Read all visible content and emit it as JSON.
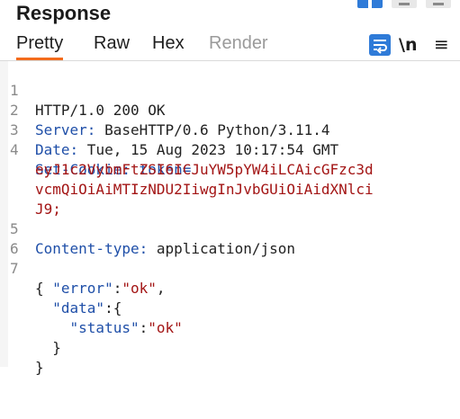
{
  "header": {
    "title": "Response"
  },
  "tabs": [
    {
      "label": "Pretty"
    },
    {
      "label": "Raw"
    },
    {
      "label": "Hex"
    },
    {
      "label": "Render"
    }
  ],
  "toolbar": {
    "newline_label": "\\n",
    "menu_glyph": "≡"
  },
  "lines": [
    {
      "num": "1",
      "text": "HTTP/1.0 200 OK"
    },
    {
      "num": "2",
      "key": "Server:",
      "value": " BaseHTTP/0.6 Python/3.11.4"
    },
    {
      "num": "3",
      "key": "Date:",
      "value": " Tue, 15 Aug 2023 10:17:54 GMT"
    },
    {
      "num": "4",
      "key": "Set-Cookie:",
      "value": " token="
    },
    {
      "num": "",
      "token": "eyJ1c2VybmFtZSI6ICJuYW5pYW4iLCAicGFzc3d"
    },
    {
      "num": "",
      "token": "vcmQiOiAiMTIzNDU2IiwgInJvbGUiOiAidXNlci"
    },
    {
      "num": "",
      "token": "J9;"
    },
    {
      "num": "5",
      "key": "Content-type:",
      "value": " application/json"
    },
    {
      "num": "6",
      "text": ""
    },
    {
      "num": "7",
      "text": "{"
    },
    {
      "num": "",
      "json_key": "\"error\"",
      "sep": ":",
      "json_val": "\"ok\"",
      "tail": ",",
      "indent": "  "
    },
    {
      "num": "",
      "json_key": "\"data\"",
      "sep": ":{",
      "json_val": "",
      "tail": "",
      "indent": "  "
    },
    {
      "num": "",
      "json_key": "\"status\"",
      "sep": ":",
      "json_val": "\"ok\"",
      "tail": "",
      "indent": "    "
    },
    {
      "num": "",
      "text": "  }"
    },
    {
      "num": "",
      "text": "}"
    }
  ]
}
